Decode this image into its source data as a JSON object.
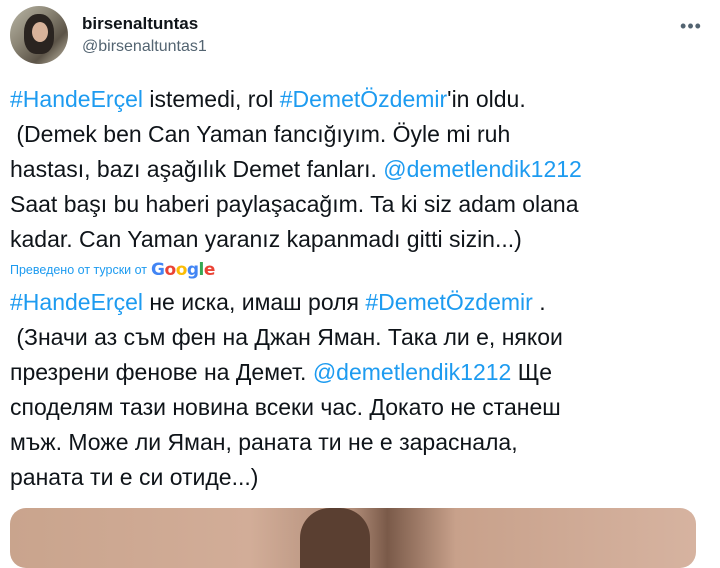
{
  "author": {
    "display_name": "birsenaltuntas",
    "handle": "@birsenaltuntas1"
  },
  "more_icon": "more-horizontal-icon",
  "tweet": {
    "lines": [
      [
        {
          "t": "#HandeErçel",
          "link": true
        },
        {
          "t": " istemedi, rol "
        },
        {
          "t": "#DemetÖzdemir",
          "link": true
        },
        {
          "t": "'in oldu."
        }
      ],
      [
        {
          "t": " (Demek ben Can Yaman fancığıyım. Öyle mi ruh"
        }
      ],
      [
        {
          "t": "hastası, bazı aşağılık Demet fanları. "
        },
        {
          "t": "@demetlendik1212",
          "link": true
        }
      ],
      [
        {
          "t": "Saat başı bu haberi paylaşacağım. Ta ki siz adam olana"
        }
      ],
      [
        {
          "t": "kadar. Can Yaman yaranız kapanmadı gitti sizin...)"
        }
      ]
    ]
  },
  "translation": {
    "label": "Преведено от турски от",
    "provider": "Google"
  },
  "translated_tweet": {
    "lines": [
      [
        {
          "t": "#HandeErçel",
          "link": true
        },
        {
          "t": " не иска, имаш роля "
        },
        {
          "t": "#DemetÖzdemir",
          "link": true
        },
        {
          "t": " ."
        }
      ],
      [
        {
          "t": " (Значи аз съм фен на Джан Яман. Така ли е, някои"
        }
      ],
      [
        {
          "t": "презрени фенове на Демет. "
        },
        {
          "t": "@demetlendik1212",
          "link": true
        },
        {
          "t": " Ще"
        }
      ],
      [
        {
          "t": "споделям тази новина всеки час. Докато не станеш"
        }
      ],
      [
        {
          "t": "мъж. Може ли Яман, раната ти не е зараснала,"
        }
      ],
      [
        {
          "t": "раната ти е си отиде...)"
        }
      ]
    ]
  },
  "colors": {
    "link": "#1d9bf0",
    "text": "#0f1419",
    "secondary": "#536471"
  }
}
